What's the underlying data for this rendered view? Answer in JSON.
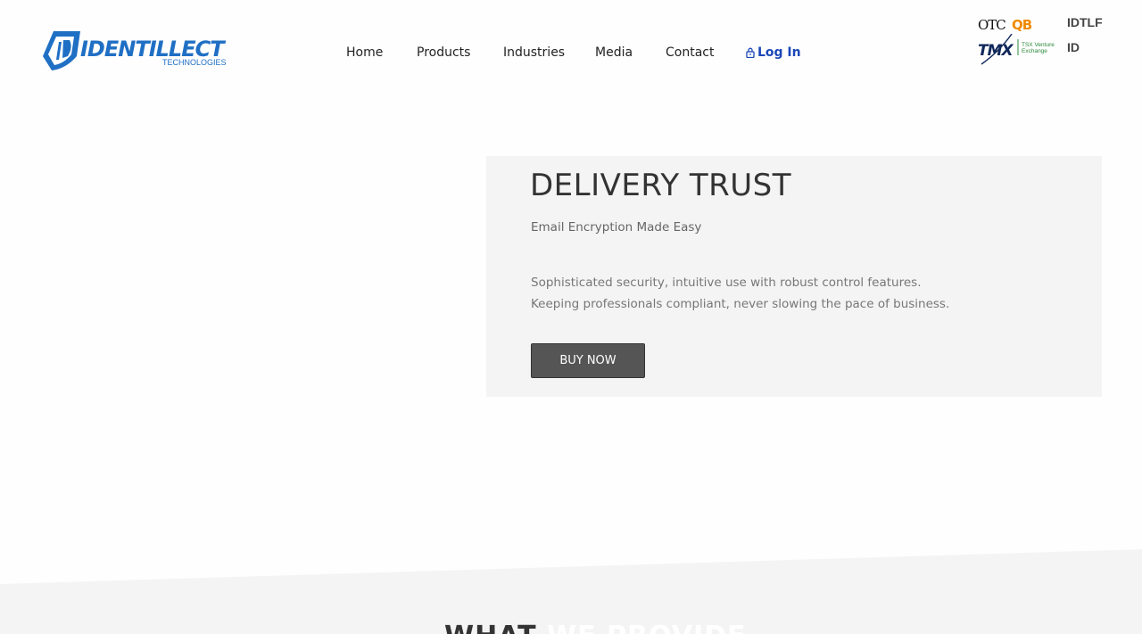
{
  "brand": {
    "name": "IDENTILLECT",
    "tagline": "TECHNOLOGIES",
    "color": "#1f6fc4"
  },
  "nav": {
    "items": [
      {
        "label": "Home"
      },
      {
        "label": "Products"
      },
      {
        "label": "Industries"
      },
      {
        "label": "Media"
      },
      {
        "label": "Contact"
      }
    ],
    "login": {
      "label": "Log In",
      "icon": "lock-icon",
      "color": "#1a46b8"
    }
  },
  "exchanges": {
    "otc": {
      "label_a": "OTC",
      "label_b": "QB",
      "ticker": "IDTLF"
    },
    "tmx": {
      "label": "TMX",
      "venture_line1": "TSX Venture",
      "venture_line2": "Exchange",
      "ticker": "ID"
    }
  },
  "hero": {
    "title": "DELIVERY TRUST",
    "subtitle": "Email Encryption Made Easy",
    "desc_line1": "Sophisticated security, intuitive use with robust control features.",
    "desc_line2": "Keeping professionals compliant, never slowing the pace of business.",
    "cta": "BUY NOW"
  },
  "section": {
    "heading_part1": "WHAT",
    "heading_part2": "WE PROVIDE"
  }
}
